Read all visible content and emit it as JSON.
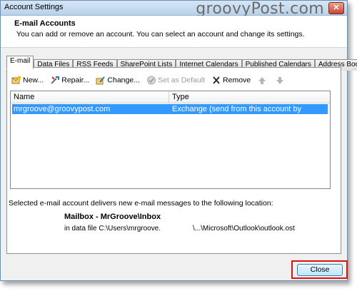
{
  "window": {
    "title": "Account Settings",
    "watermark": "groovyPost.com"
  },
  "header": {
    "title": "E-mail Accounts",
    "description": "You can add or remove an account. You can select an account and change its settings."
  },
  "tabs": [
    {
      "label": "E-mail",
      "active": true
    },
    {
      "label": "Data Files"
    },
    {
      "label": "RSS Feeds"
    },
    {
      "label": "SharePoint Lists"
    },
    {
      "label": "Internet Calendars"
    },
    {
      "label": "Published Calendars"
    },
    {
      "label": "Address Books"
    }
  ],
  "toolbar": {
    "new_label": "New...",
    "repair_label": "Repair...",
    "change_label": "Change...",
    "default_label": "Set as Default",
    "remove_label": "Remove"
  },
  "accounts_list": {
    "columns": [
      "Name",
      "Type"
    ],
    "rows": [
      {
        "name": "mrgroove@groovypost.com",
        "type": "Exchange (send from this account by default)"
      }
    ]
  },
  "delivery": {
    "note": "Selected e-mail account delivers new e-mail messages to the following location:",
    "mailbox": "Mailbox - MrGroove\\Inbox",
    "data_file_prefix": "in data file C:\\Users\\mrgroove.",
    "data_file_path": "\\...\\Microsoft\\Outlook\\outlook.ost"
  },
  "footer": {
    "close_label": "Close"
  },
  "colors": {
    "selection": "#3399ff",
    "highlight_border": "#e01010"
  }
}
